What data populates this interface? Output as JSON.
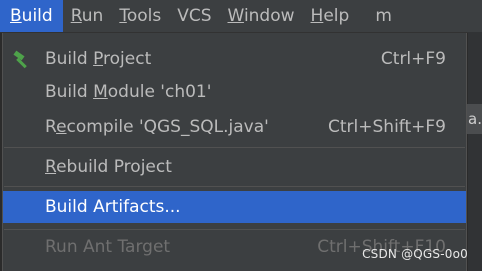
{
  "menubar": {
    "items": [
      {
        "label": "Build",
        "mnemonic": "B",
        "rest": "uild"
      },
      {
        "label": "Run",
        "mnemonic": "R",
        "rest": "un",
        "pre": ""
      },
      {
        "label": "Tools",
        "mnemonic": "T",
        "rest": "ools"
      },
      {
        "label": "VCS",
        "mnemonic": "",
        "rest": "VCS"
      },
      {
        "label": "Window",
        "mnemonic": "W",
        "rest": "indow"
      },
      {
        "label": "Help",
        "mnemonic": "H",
        "rest": "elp"
      }
    ],
    "truncated": "m"
  },
  "build_menu": {
    "items": [
      {
        "pre": "Build ",
        "mnemonic": "P",
        "post": "roject",
        "shortcut": "Ctrl+F9",
        "icon": "hammer-icon"
      },
      {
        "pre": "Build ",
        "mnemonic": "M",
        "post": "odule 'ch01'",
        "shortcut": ""
      },
      {
        "pre": "R",
        "mnemonic": "e",
        "post": "compile 'QGS_SQL.java'",
        "shortcut": "Ctrl+Shift+F9"
      },
      {
        "pre": "",
        "mnemonic": "R",
        "post": "ebuild Project",
        "shortcut": ""
      },
      {
        "pre": "Build Artifacts...",
        "mnemonic": "",
        "post": "",
        "shortcut": ""
      },
      {
        "pre": "Run Ant Target",
        "mnemonic": "",
        "post": "",
        "shortcut": "Ctrl+Shift+F10"
      }
    ]
  },
  "background": {
    "tab_fragment": "a.\\"
  },
  "watermark": "CSDN @QGS-0o0",
  "colors": {
    "accent": "#2f65ca",
    "menu_bg": "#3c3f41",
    "hammer": "#4ea24a"
  }
}
